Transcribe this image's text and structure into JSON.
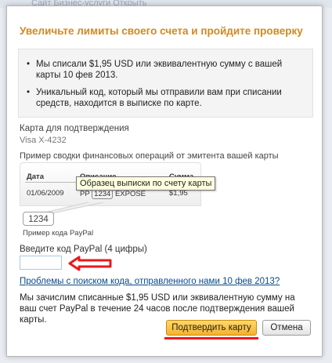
{
  "background": {
    "text": "Сайт Бизнес-услуги   Открыть"
  },
  "dialog": {
    "title": "Увеличьте лимиты своего счета и пройдите проверку",
    "bullets": [
      "Мы списали $1,95 USD или эквивалентную сумму с вашей карты 10 фев 2013.",
      "Уникальный код, который мы отправили вам при списании средств, находится в выписке по карте."
    ],
    "card": {
      "label": "Карта для подтверждения",
      "number": "Visa X-4232"
    },
    "sample": {
      "label": "Пример сводки финансовых операций от эмитента вашей карты",
      "headers": [
        "Дата",
        "Описание",
        "Сумма"
      ],
      "row": {
        "date": "01/06/2009",
        "desc_prefix": "PP",
        "code": "1234",
        "desc_suffix": "EXPOSE",
        "amount": "$1,95"
      },
      "tooltip": "Образец выписки по счету карты",
      "code_bubble": "1234",
      "code_caption": "Пример кода PayPal"
    },
    "code_input": {
      "label": "Введите код PayPal (4 цифры)",
      "value": "",
      "placeholder": ""
    },
    "help_link": "Проблемы с поиском кода, отправленного нами 10 фев 2013?",
    "refund_text": "Мы зачислим списанные $1,95 USD или эквивалентную сумму на ваш счет PayPal в течение 24 часов после подтверждения вашей карты.",
    "buttons": {
      "confirm": "Подтвердить карту",
      "cancel": "Отмена"
    },
    "colors": {
      "title": "#d4881e",
      "link": "#084b8a",
      "annotation": "#e8191c",
      "confirm_button": "#f5b22d"
    }
  }
}
